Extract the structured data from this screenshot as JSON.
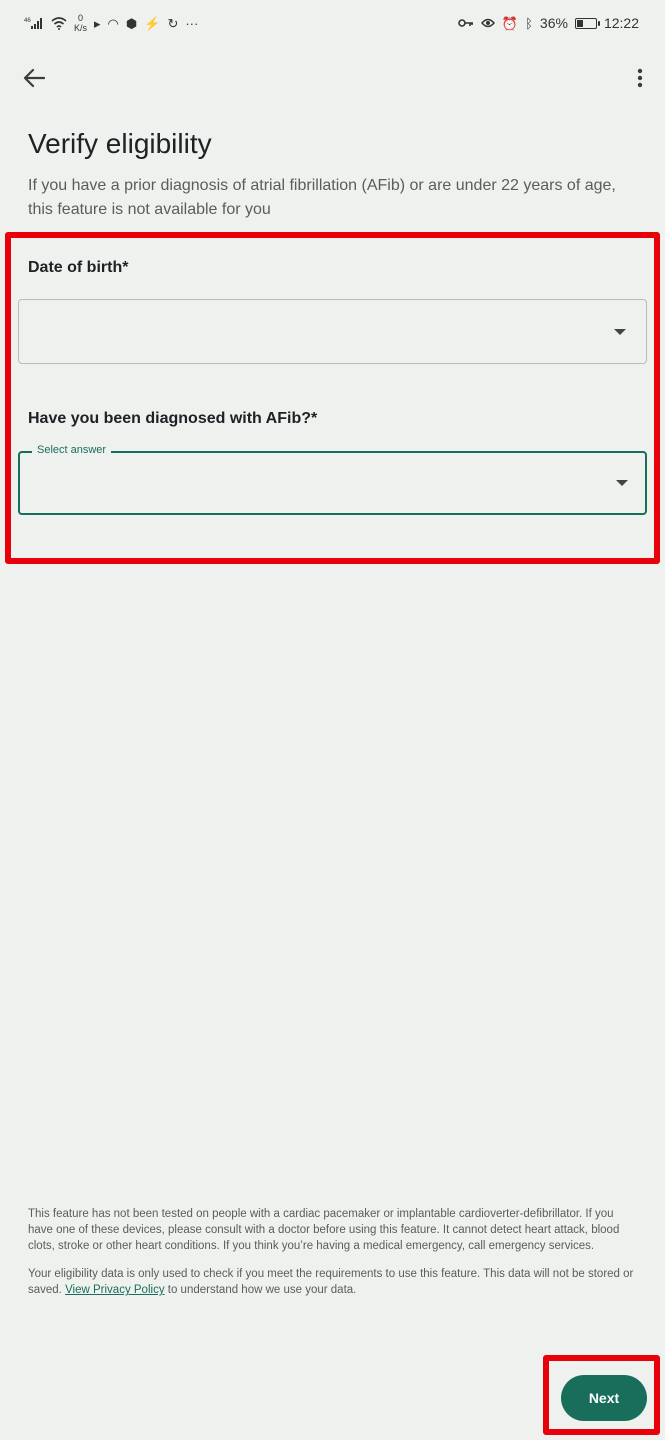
{
  "status_bar": {
    "network": "46",
    "data_rate_value": "0",
    "data_rate_unit": "K/s",
    "more": "···",
    "battery": "36%",
    "time": "12:22",
    "battery_level": 0.36
  },
  "header": {
    "title": "Verify eligibility",
    "subtitle": "If you have a prior diagnosis of atrial fibrillation (AFib) or are under 22 years of age, this feature is not available for you"
  },
  "form": {
    "dob_label": "Date of birth*",
    "dob_value": "",
    "afib_label": "Have you been diagnosed with AFib?*",
    "afib_floating_label": "Select answer",
    "afib_value": ""
  },
  "disclaimer": {
    "paragraph1": "This feature has not been tested on people with a cardiac pacemaker or implantable cardioverter-defibrillator. If you have one of these devices, please consult with a doctor before using this feature. It cannot detect heart attack, blood clots, stroke or other heart conditions. If you think you’re having a medical emergency, call emergency services.",
    "paragraph2_before": "Your eligibility data is only used to check if you meet the requirements to use this feature. This data will not be stored or saved. ",
    "privacy_link": "View Privacy Policy",
    "paragraph2_after": " to understand how we use your data."
  },
  "actions": {
    "next_label": "Next"
  },
  "colors": {
    "accent": "#186e5a",
    "highlight": "#e8000b",
    "background": "#eff1ef"
  },
  "icons": {
    "back": "arrow-back-icon",
    "more": "more-vert-icon",
    "dropdown": "arrow-drop-down-icon"
  }
}
